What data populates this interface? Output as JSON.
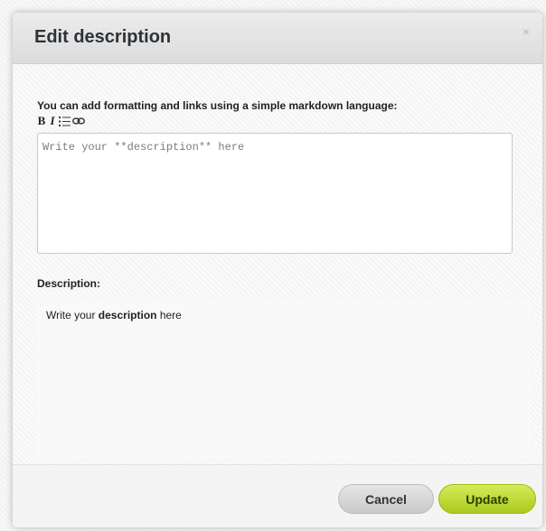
{
  "dialog": {
    "title": "Edit description",
    "close_label": "×"
  },
  "editor": {
    "instructions": "You can add formatting and links using a simple markdown language:",
    "toolbar": [
      {
        "name": "bold",
        "label": "B"
      },
      {
        "name": "italic",
        "label": "I"
      },
      {
        "name": "list",
        "icon": "list-icon"
      },
      {
        "name": "link",
        "icon": "link-icon"
      }
    ],
    "placeholder": "Write your **description** here",
    "value": ""
  },
  "preview": {
    "label": "Description:",
    "text_before": "Write your ",
    "text_bold": "description",
    "text_after": " here"
  },
  "footer": {
    "cancel_label": "Cancel",
    "update_label": "Update"
  },
  "colors": {
    "update_button": "#bcd83a",
    "cancel_button": "#d6d6d6",
    "title_text": "#2d3238"
  }
}
